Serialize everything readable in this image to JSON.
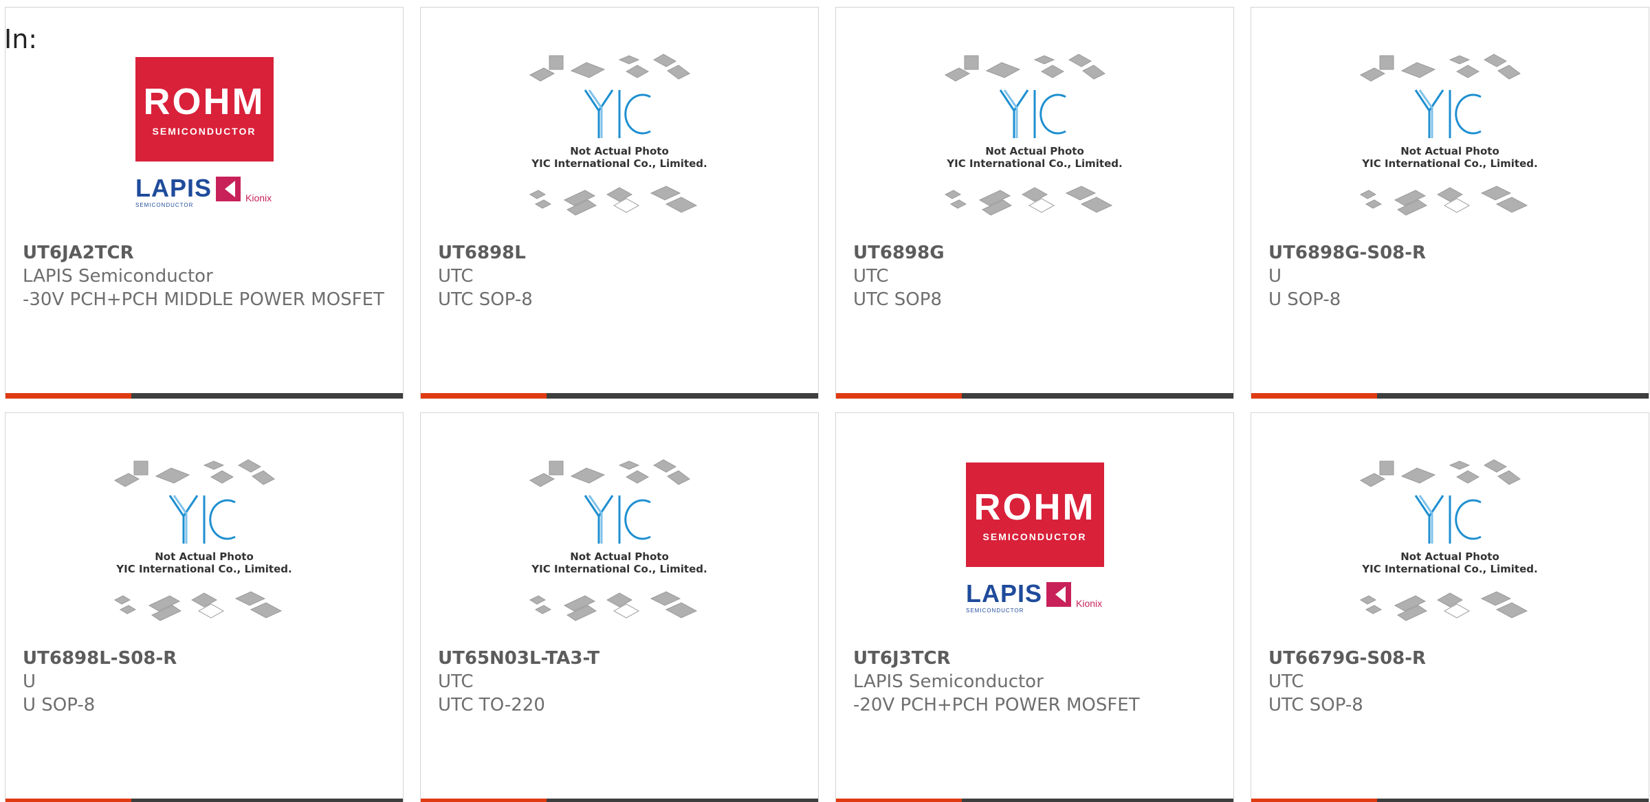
{
  "header": {
    "label": "In:"
  },
  "colors": {
    "accent": "#e03a12",
    "bar": "#3e3e3e",
    "rohm_red": "#d9213a",
    "lapis_blue": "#1f4b9b",
    "yic_blue": "#1e8fd0"
  },
  "products": [
    {
      "part_number": "UT6JA2TCR",
      "manufacturer": "LAPIS Semiconductor",
      "description": "-30V PCH+PCH MIDDLE POWER MOSFET",
      "image": "rohm-lapis-logo"
    },
    {
      "part_number": "UT6898L",
      "manufacturer": "UTC",
      "description": "UTC SOP-8",
      "image": "yic-not-actual-photo"
    },
    {
      "part_number": "UT6898G",
      "manufacturer": "UTC",
      "description": "UTC SOP8",
      "image": "yic-not-actual-photo"
    },
    {
      "part_number": "UT6898G-S08-R",
      "manufacturer": "U",
      "description": "U SOP-8",
      "image": "yic-not-actual-photo"
    },
    {
      "part_number": "UT6898L-S08-R",
      "manufacturer": "U",
      "description": "U SOP-8",
      "image": "yic-not-actual-photo"
    },
    {
      "part_number": "UT65N03L-TA3-T",
      "manufacturer": "UTC",
      "description": "UTC TO-220",
      "image": "yic-not-actual-photo"
    },
    {
      "part_number": "UT6J3TCR",
      "manufacturer": "LAPIS Semiconductor",
      "description": "-20V PCH+PCH POWER MOSFET",
      "image": "rohm-lapis-logo"
    },
    {
      "part_number": "UT6679G-S08-R",
      "manufacturer": "UTC",
      "description": "UTC SOP-8",
      "image": "yic-not-actual-photo"
    }
  ],
  "logos": {
    "rohm": {
      "title": "ROHM",
      "subtitle": "SEMICONDUCTOR",
      "lapis": "LAPIS",
      "lapis_sub": "SEMICONDUCTOR",
      "kionix": "Kionix"
    },
    "yic": {
      "mark": "YIC",
      "line1": "Not Actual Photo",
      "line2": "YIC International Co., Limited."
    }
  }
}
